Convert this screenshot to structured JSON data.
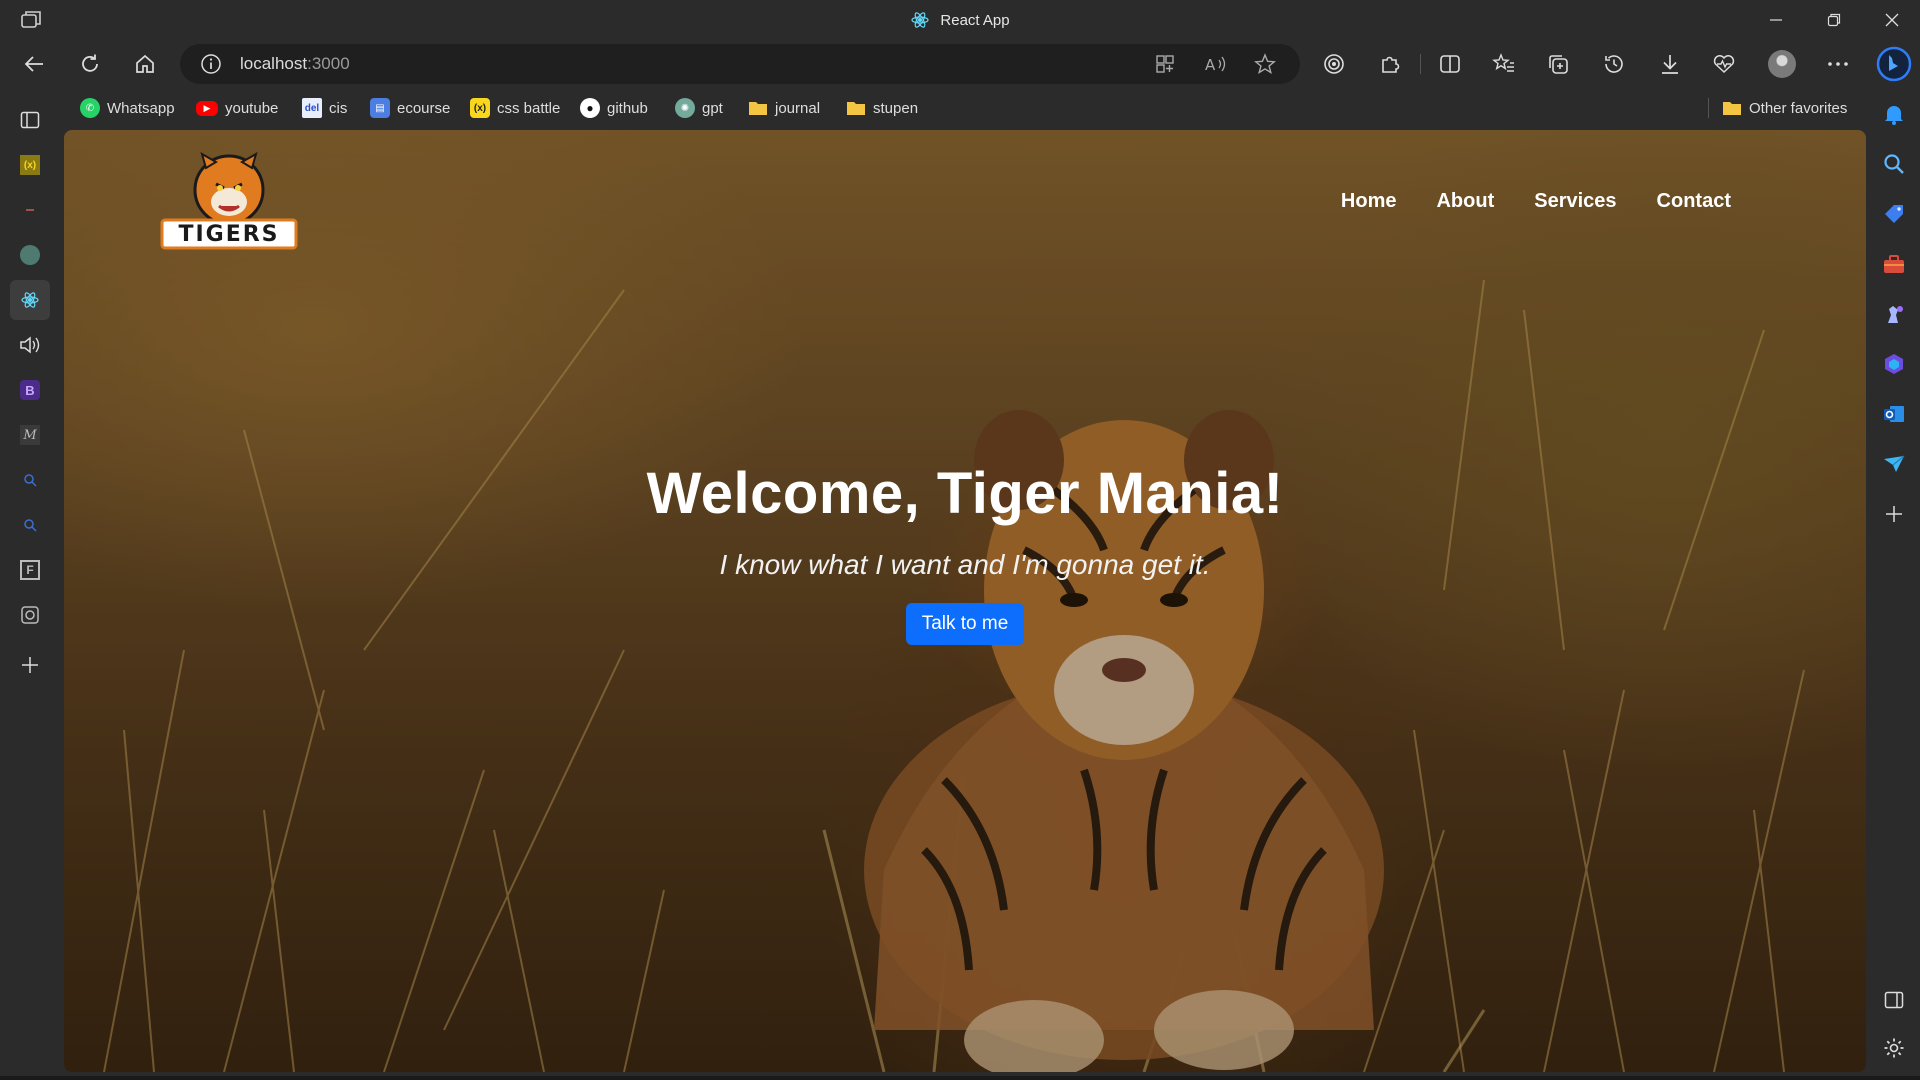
{
  "browser": {
    "window_title": "React App",
    "url_host": "localhost",
    "url_port": ":3000"
  },
  "favorites": {
    "items": [
      {
        "label": "Whatsapp",
        "icon": "whatsapp-icon",
        "color": "#25d366"
      },
      {
        "label": "youtube",
        "icon": "youtube-icon",
        "color": "#ff0000"
      },
      {
        "label": "cis",
        "icon": "del-icon",
        "color": "#3b5bdb"
      },
      {
        "label": "ecourse",
        "icon": "ecourse-icon",
        "color": "#4c7de0"
      },
      {
        "label": "css battle",
        "icon": "css-battle-icon",
        "color": "#f9d71c"
      },
      {
        "label": "github",
        "icon": "github-icon",
        "color": "#ffffff"
      },
      {
        "label": "gpt",
        "icon": "gpt-icon",
        "color": "#74aa9c"
      },
      {
        "label": "journal",
        "icon": "folder-icon",
        "color": "#f4c542"
      },
      {
        "label": "stupen",
        "icon": "folder-icon",
        "color": "#f4c542"
      }
    ],
    "other_label": "Other favorites"
  },
  "page": {
    "logo_text": "TIGERS",
    "nav": [
      "Home",
      "About",
      "Services",
      "Contact"
    ],
    "heading": "Welcome, Tiger Mania!",
    "tagline": "I know what I want and I'm gonna get it.",
    "cta_label": "Talk to me",
    "accent_color": "#0d6efd"
  },
  "left_tabs": [
    {
      "icon": "sidebar-toggle-icon"
    },
    {
      "icon": "css-battle-tab-icon"
    },
    {
      "icon": "blank-tab-icon"
    },
    {
      "icon": "gpt-tab-icon"
    },
    {
      "icon": "react-tab-icon",
      "active": true
    },
    {
      "icon": "audio-tab-icon"
    },
    {
      "icon": "bootstrap-tab-icon"
    },
    {
      "icon": "medium-tab-icon"
    },
    {
      "icon": "search-tab-icon"
    },
    {
      "icon": "search-tab-icon"
    },
    {
      "icon": "f-tab-icon"
    },
    {
      "icon": "extension-tab-icon"
    },
    {
      "icon": "new-tab-plus-icon"
    }
  ],
  "right_sidebar": [
    "bing-copilot-icon",
    "notification-bell-icon",
    "search-icon",
    "shopping-tag-icon",
    "tools-briefcase-icon",
    "games-chess-icon",
    "microsoft365-icon",
    "outlook-icon",
    "drop-icon",
    "add-icon",
    "hide-sidebar-icon",
    "settings-gear-icon"
  ]
}
